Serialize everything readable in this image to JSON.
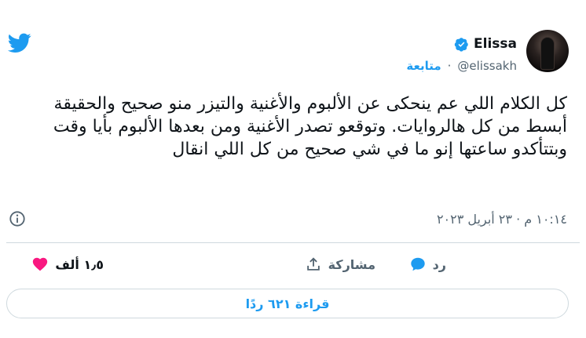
{
  "user": {
    "display_name": "Elissa",
    "handle": "@elissakh",
    "separator": "·",
    "follow_label": "متابعة"
  },
  "tweet": {
    "text": "كل الكلام اللي عم ينحكى عن الألبوم والأغنية والتيزر منو صحيح والحقيقة أبسط من كل هالروايات. وتوقعو تصدر الأغنية ومن بعدها الألبوم بأيا وقت وبتتأكدو ساعتها إنو ما في شي صحيح من كل اللي انقال",
    "timestamp": "١٠:١٤ م · ٢٣ أبريل ٢٠٢٣"
  },
  "actions": {
    "likes_count": "١٫٥ ألف",
    "reply_label": "رد",
    "share_label": "مشاركة"
  },
  "footer": {
    "read_replies_label": "قراءة ٦٢١ ردًا"
  },
  "colors": {
    "brand_blue": "#1d9bf0",
    "like_pink": "#f91880",
    "muted": "#536471",
    "text": "#0f1419",
    "border": "#cfd9de"
  },
  "icons": {
    "brand": "twitter-bird-icon",
    "verified": "verified-badge-icon",
    "info": "info-icon",
    "like": "heart-icon",
    "reply": "chat-bubble-icon",
    "share": "share-upload-icon"
  }
}
